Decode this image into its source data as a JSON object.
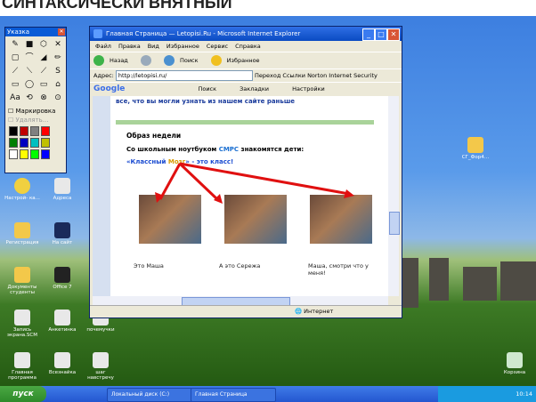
{
  "heading_overlay": "СИНТАКСИЧЕСКИ ВНЯТНЫЙ",
  "palette": {
    "title": "Указка",
    "tools": [
      "✎",
      "■",
      "⬡",
      "✕",
      "▢",
      "⌒",
      "◢",
      "✏",
      "⟋",
      "⟍",
      "⟋",
      "S",
      "▭",
      "◯",
      "▭",
      "⌂",
      "Aa",
      "⟲",
      "⊗",
      "⊙"
    ],
    "options": [
      "Маркировка",
      "Удалять..."
    ],
    "colors": [
      "#000000",
      "#c00000",
      "#808080",
      "#ff0000",
      "#008000",
      "#0000c0",
      "#00c0c0",
      "#c0c000",
      "#ffffff",
      "#ffff00",
      "#00ff00",
      "#0000ff"
    ]
  },
  "browser": {
    "title": "Главная Страница — Letopisi.Ru - Microsoft Internet Explorer",
    "menu": [
      "Файл",
      "Правка",
      "Вид",
      "Избранное",
      "Сервис",
      "Справка"
    ],
    "toolbar": [
      "Назад",
      "Вперед",
      "Поиск",
      "Избранное"
    ],
    "address_label": "Адрес:",
    "address_value": "http://letopisi.ru/",
    "go_label": "Переход",
    "links_label": "Ссылки",
    "norton_label": "Norton Internet Security",
    "google_label": "Google",
    "search_label": "Поиск",
    "bookmarks_label": "Закладки",
    "settings_label": "Настройки",
    "page": {
      "prev_text": "все, что вы могли узнать из нашем сайте раньше",
      "heading": "Образ недели",
      "sub_pre": "Со школьным ноутбуком",
      "sub_accent": "СМРС",
      "sub_post": "знакомятся дети:",
      "link_q1": "«Классный",
      "link_mid": "Мозг",
      "link_q2": "» - это класс!",
      "captions": [
        "Это Маша",
        "А это Сережа",
        "Маша, смотри что у меня!"
      ]
    },
    "status_zone": "Интернет"
  },
  "desktop_icons": [
    {
      "label": "Настрой- ка..."
    },
    {
      "label": "Адреса"
    },
    {
      "label": "Регистрация"
    },
    {
      "label": "На сайт"
    },
    {
      "label": "Документы студенты"
    },
    {
      "label": "Office 7"
    },
    {
      "label": "Запись экрана.SCM"
    },
    {
      "label": "Анкетинка"
    },
    {
      "label": "почемучки"
    },
    {
      "label": "Главная программа"
    },
    {
      "label": "Всезнайка"
    },
    {
      "label": "шаг навстречу"
    },
    {
      "label": "СГ_Фор4…"
    },
    {
      "label": "Корзина"
    }
  ],
  "taskbar": {
    "start_label": "пуск",
    "buttons": [
      "Локальный диск (C:)",
      "Главная Страница"
    ],
    "clock": "10:14"
  }
}
